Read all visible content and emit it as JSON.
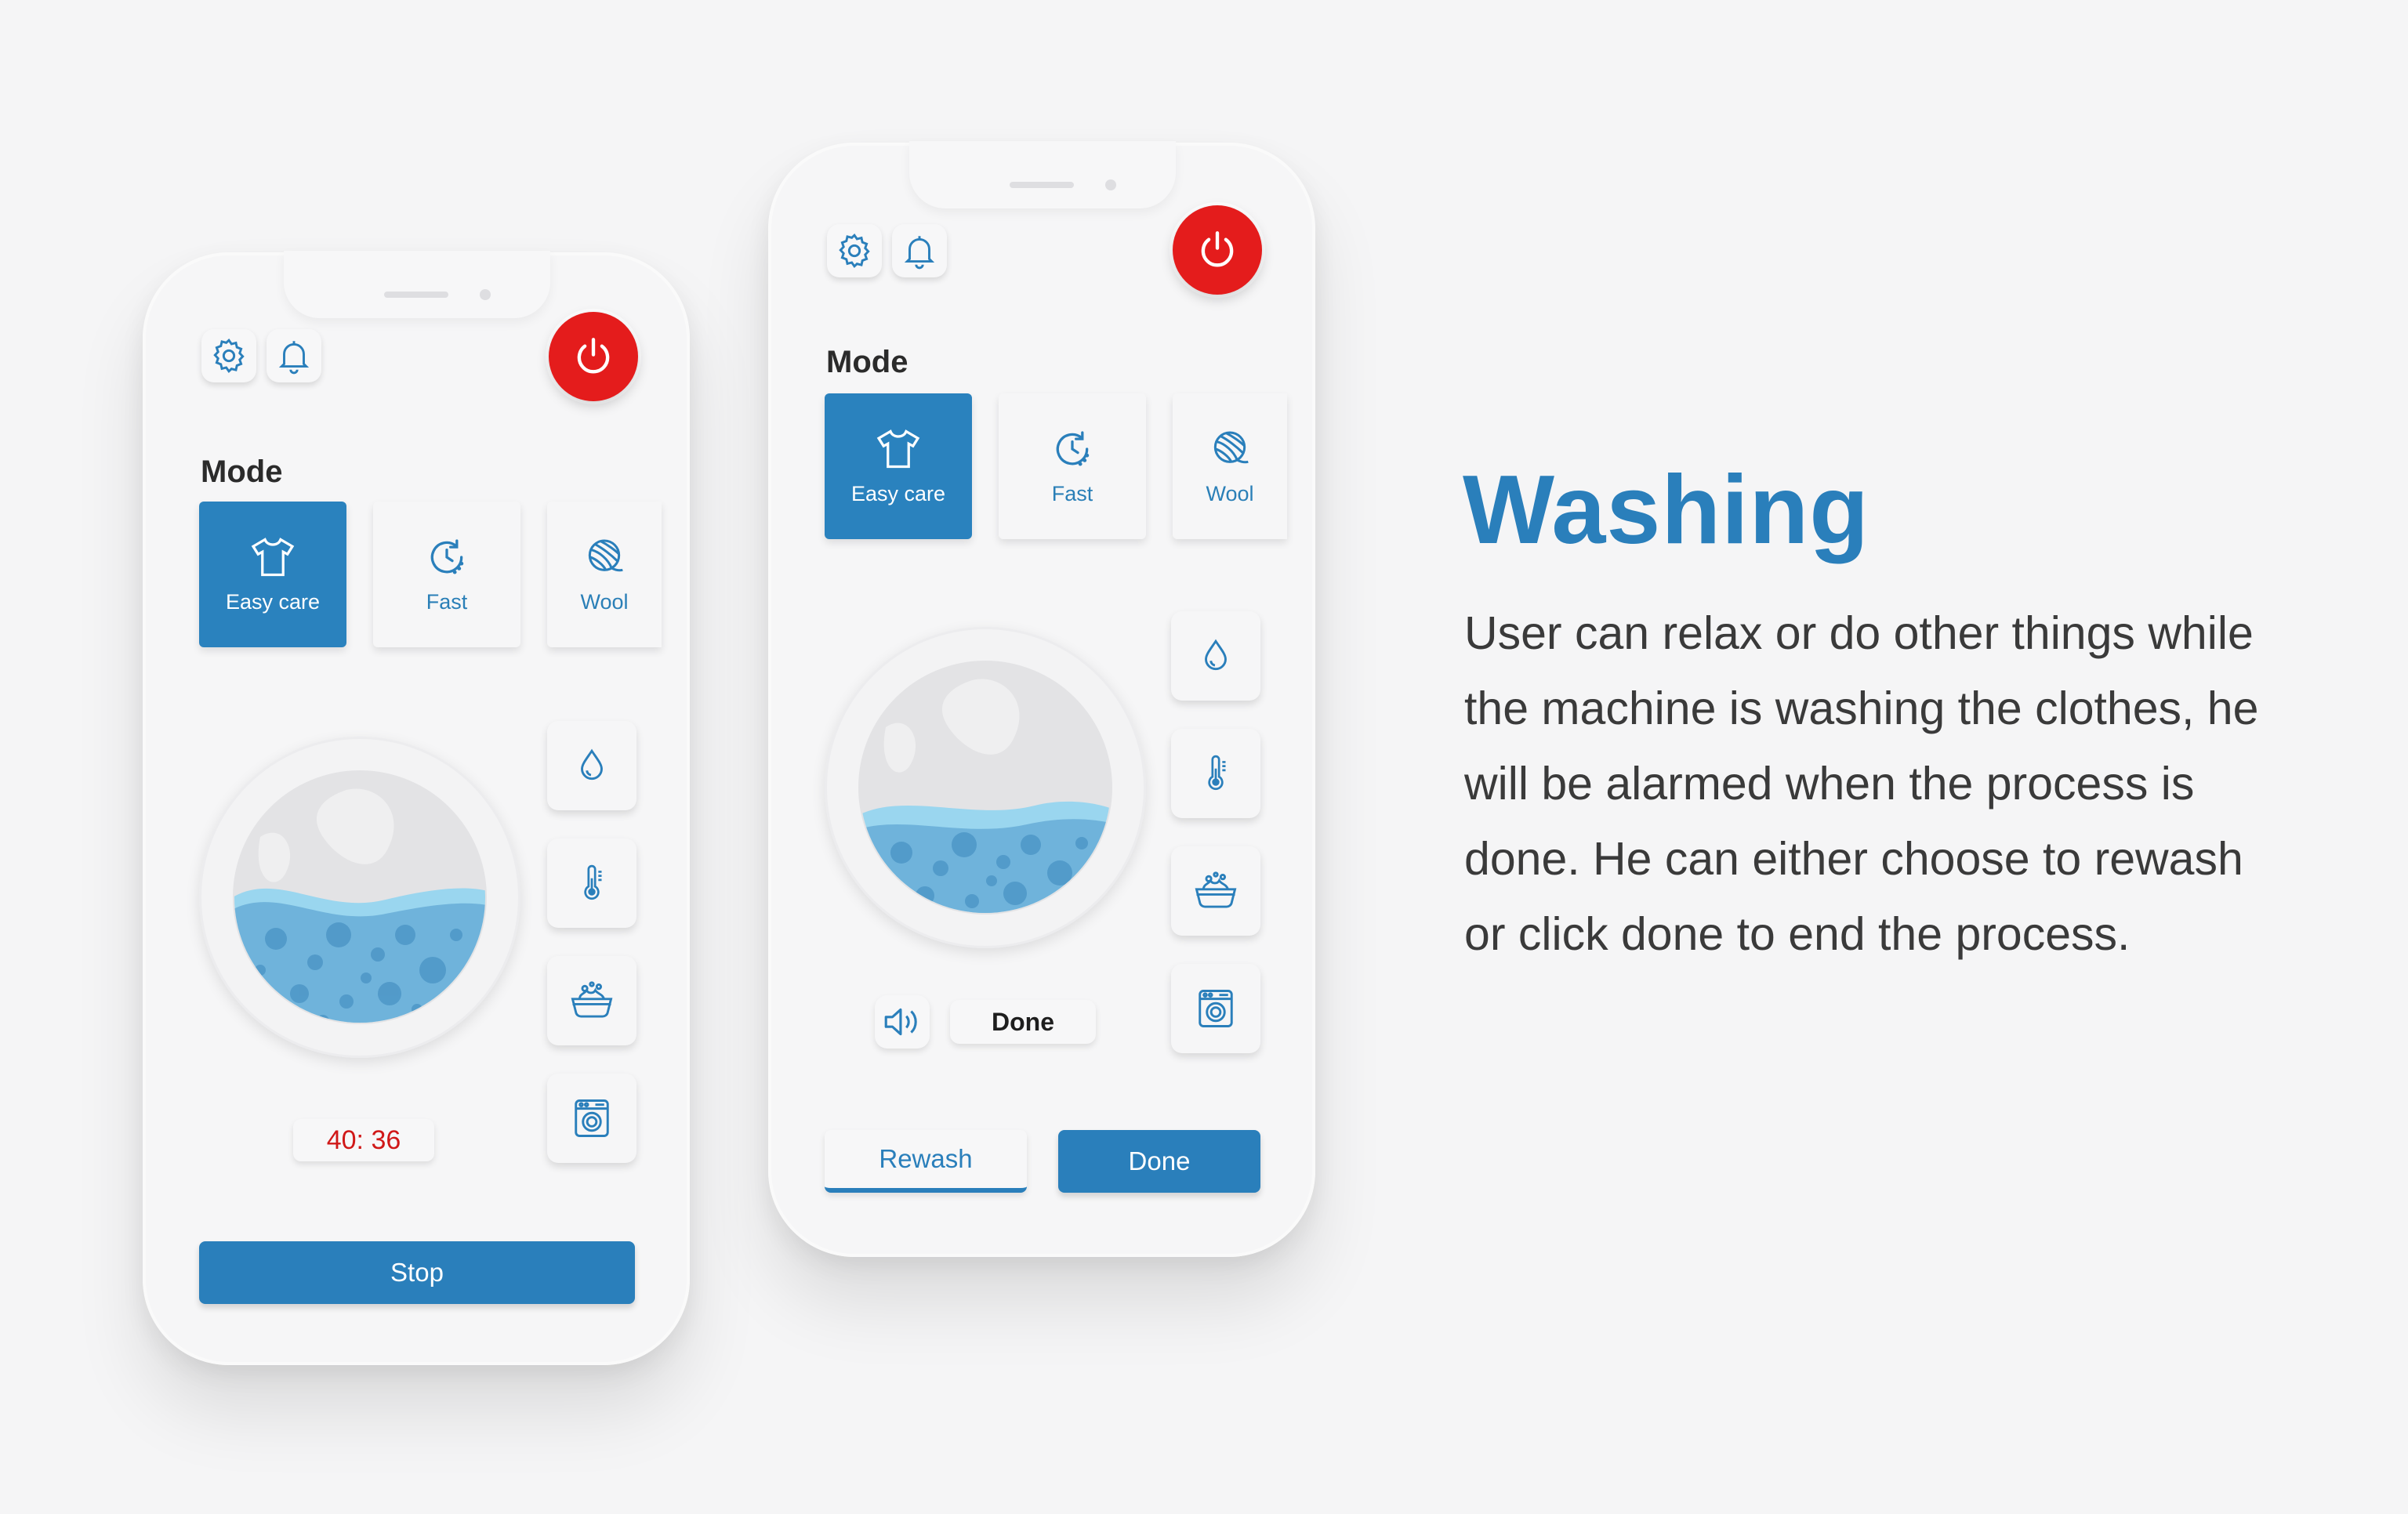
{
  "colors": {
    "accent": "#2a7fbb",
    "power": "#e41c1c",
    "timer_text": "#d01818",
    "background": "#f5f5f6"
  },
  "phone_left": {
    "mode_title": "Mode",
    "modes": [
      {
        "label": "Easy care",
        "icon": "tshirt-icon",
        "active": true
      },
      {
        "label": "Fast",
        "icon": "fast-timer-icon",
        "active": false
      },
      {
        "label": "Wool",
        "icon": "wool-yarn-icon",
        "active": false
      }
    ],
    "side_buttons": [
      "water-drop-icon",
      "thermometer-icon",
      "wash-basin-icon",
      "washing-machine-icon"
    ],
    "timer": "40: 36",
    "stop_label": "Stop"
  },
  "phone_right": {
    "mode_title": "Mode",
    "modes": [
      {
        "label": "Easy care",
        "icon": "tshirt-icon",
        "active": true
      },
      {
        "label": "Fast",
        "icon": "fast-timer-icon",
        "active": false
      },
      {
        "label": "Wool",
        "icon": "wool-yarn-icon",
        "active": false
      }
    ],
    "side_buttons": [
      "water-drop-icon",
      "thermometer-icon",
      "wash-basin-icon",
      "washing-machine-icon"
    ],
    "status_label": "Done",
    "rewash_label": "Rewash",
    "done_label": "Done"
  },
  "text": {
    "headline": "Washing",
    "description": "User can relax or do other things while the machine is washing the clothes, he will be alarmed when the process is done. He can either choose to rewash or click  done to end the process."
  }
}
